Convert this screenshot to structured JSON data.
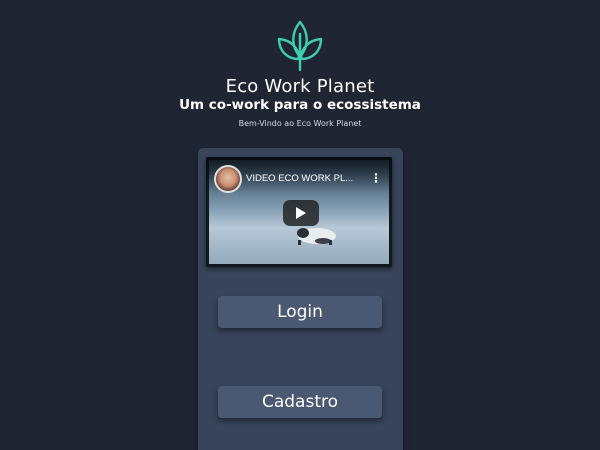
{
  "branding": {
    "logo_icon": "leaf-logo-icon",
    "logo_color": "#3ecfb2",
    "title": "Eco Work Planet",
    "subtitle": "Um co-work para o ecossistema",
    "welcome": "Bem-Vindo ao Eco Work Planet"
  },
  "video": {
    "title": "VIDEO ECO WORK PL...",
    "menu_icon": "more-vert-icon",
    "play_icon": "play-icon"
  },
  "actions": {
    "login_label": "Login",
    "signup_label": "Cadastro"
  },
  "colors": {
    "background": "#1f2533",
    "panel": "#38445a",
    "button": "#4a5872"
  }
}
